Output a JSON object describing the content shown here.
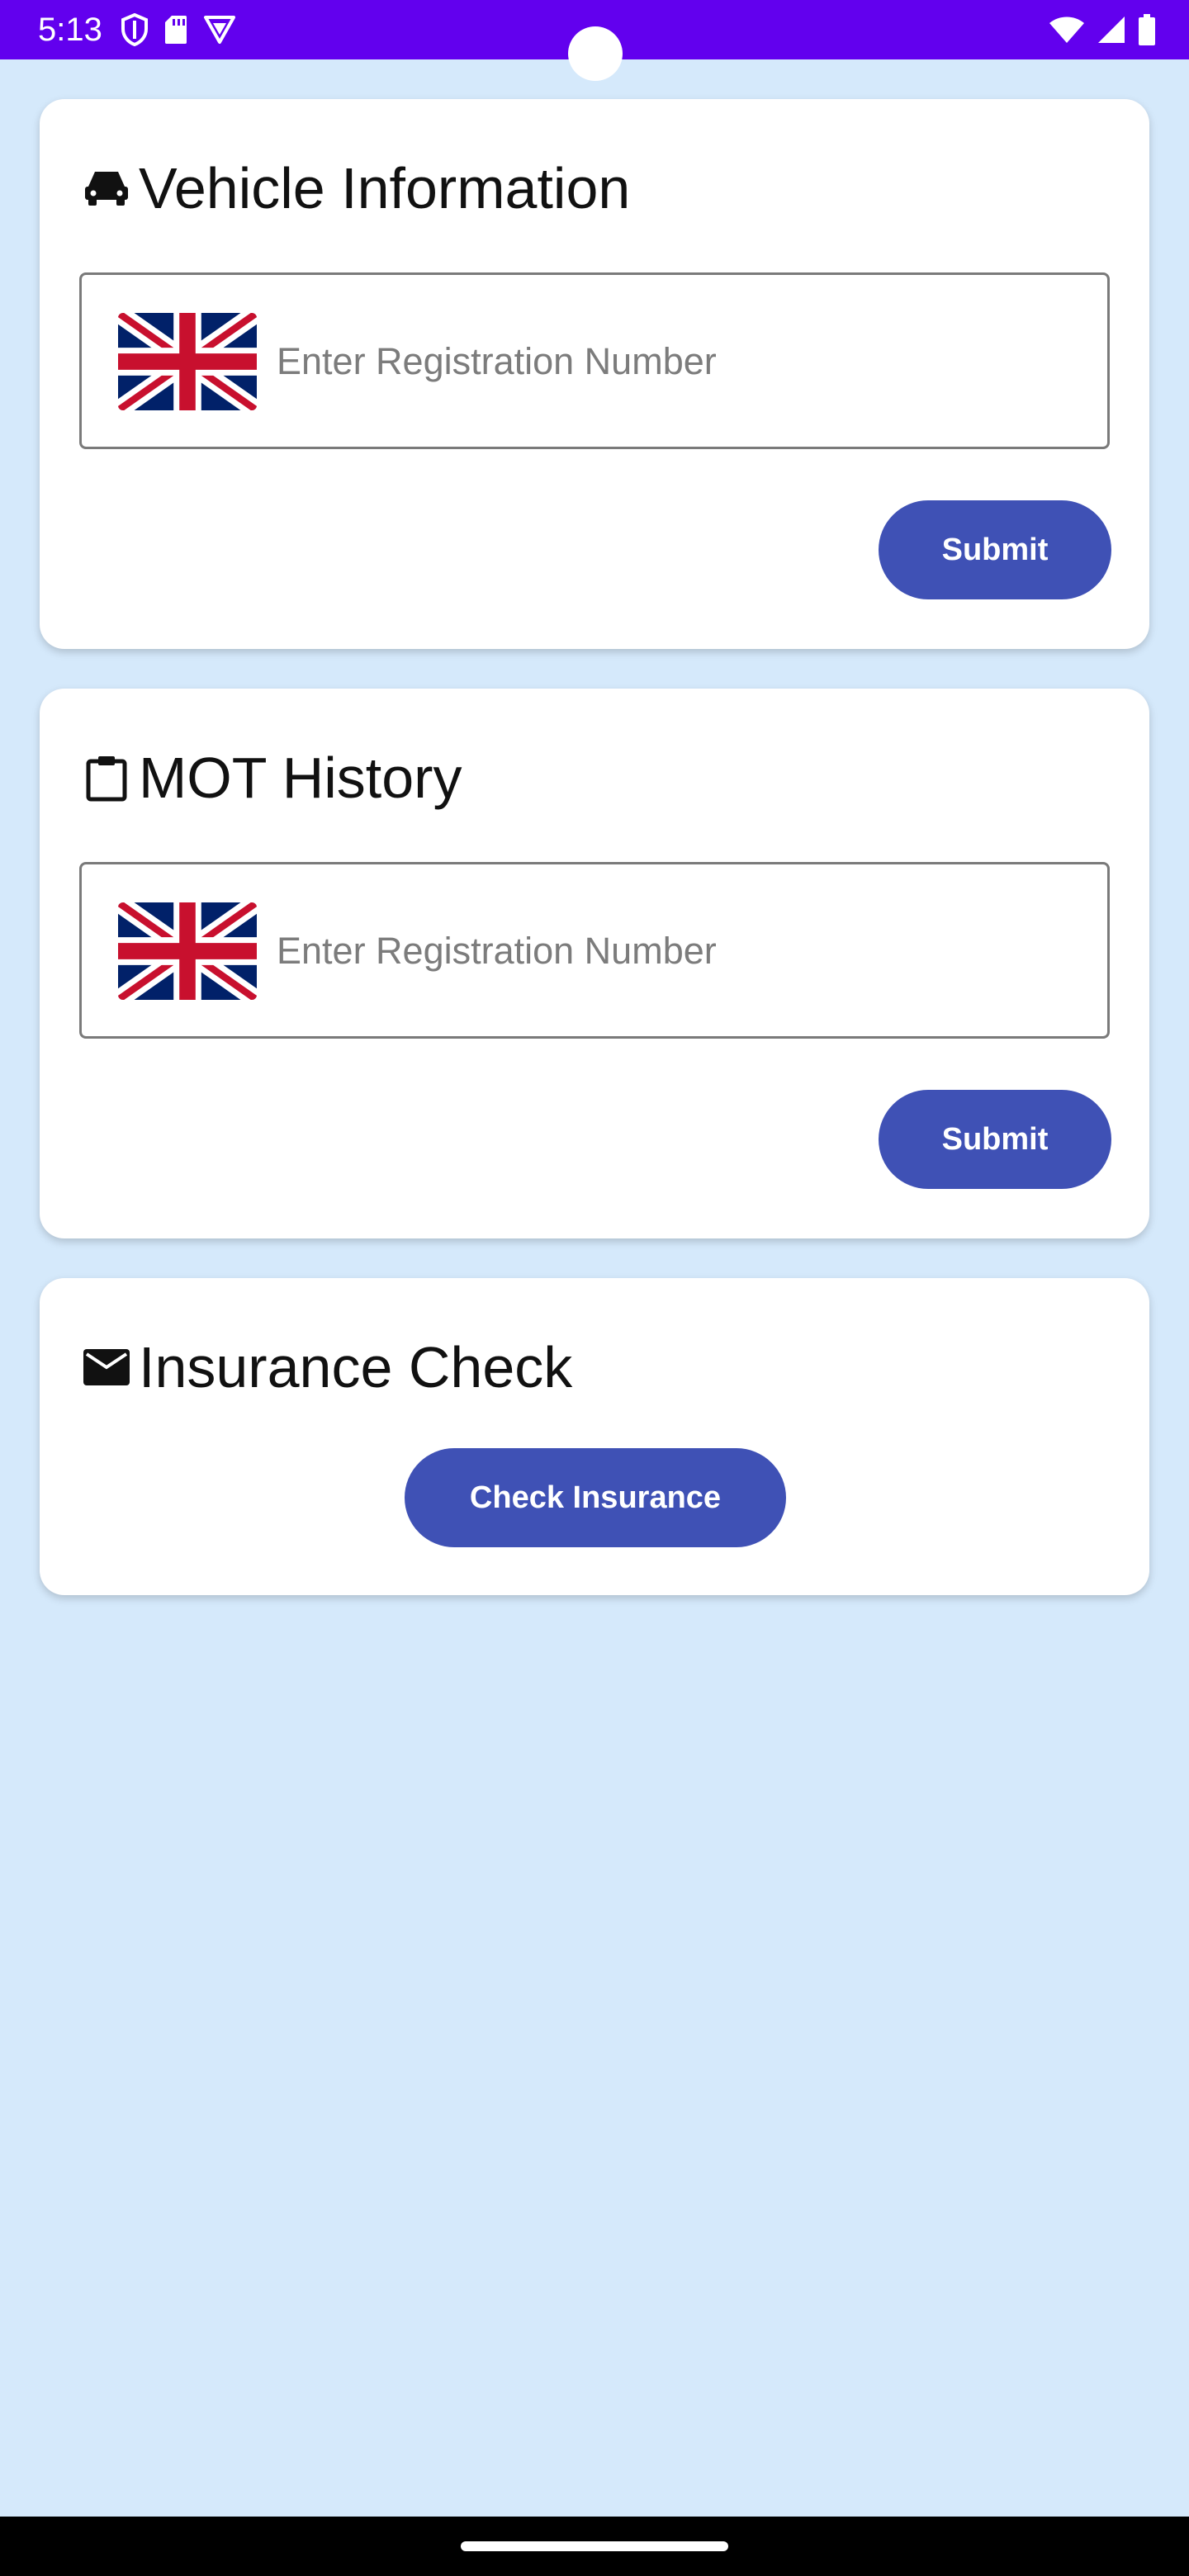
{
  "status_bar": {
    "time": "5:13",
    "left_icons": [
      "shield-icon",
      "sd-card-icon",
      "vpn-icon"
    ],
    "right_icons": [
      "wifi-icon",
      "signal-icon",
      "battery-icon"
    ]
  },
  "vehicle_card": {
    "icon": "car-icon",
    "title": "Vehicle Information",
    "input_placeholder": "Enter Registration Number",
    "input_value": "",
    "flag_icon": "uk-flag-icon",
    "submit_label": "Submit"
  },
  "mot_card": {
    "icon": "clipboard-icon",
    "title": "MOT History",
    "input_placeholder": "Enter Registration Number",
    "input_value": "",
    "flag_icon": "uk-flag-icon",
    "submit_label": "Submit"
  },
  "insurance_card": {
    "icon": "envelope-icon",
    "title": "Insurance Check",
    "button_label": "Check Insurance"
  },
  "colors": {
    "status_bar": "#6200ee",
    "background": "#d5e9fb",
    "button": "#3f51b5",
    "card": "#ffffff"
  }
}
